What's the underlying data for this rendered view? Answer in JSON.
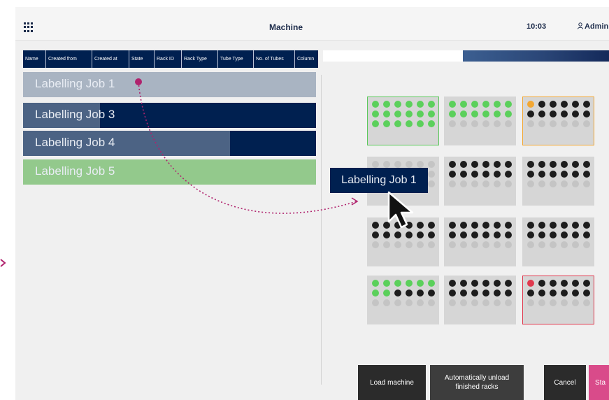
{
  "header": {
    "title": "Machine",
    "time": "10:03",
    "user": "Admin"
  },
  "table": {
    "columns": [
      "Name",
      "Created from",
      "Created at",
      "State",
      "Rack ID",
      "Rack Type",
      "Tube Type",
      "No. of Tubes",
      "Column"
    ]
  },
  "jobs": [
    {
      "label": "Labelling Job 1",
      "state": "dragging"
    },
    {
      "label": "Labelling Job 3",
      "progress": 0.26
    },
    {
      "label": "Labelling Job 4",
      "progress": 0.71
    },
    {
      "label": "Labelling Job 5",
      "state": "finished"
    }
  ],
  "drag_label": "Labelling Job 1",
  "racks": [
    {
      "state": "done",
      "tubes": [
        "g",
        "g",
        "g",
        "g",
        "g",
        "g",
        "g",
        "g",
        "g",
        "g",
        "g",
        "g",
        "g",
        "g",
        "g",
        "g",
        "g",
        "g"
      ]
    },
    {
      "state": "normal",
      "tubes": [
        "g",
        "g",
        "g",
        "g",
        "g",
        "g",
        "g",
        "g",
        "g",
        "g",
        "g",
        "g",
        "e",
        "e",
        "e",
        "e",
        "e",
        "e"
      ]
    },
    {
      "state": "warning",
      "tubes": [
        "o",
        "d",
        "d",
        "d",
        "d",
        "d",
        "d",
        "d",
        "d",
        "d",
        "d",
        "d",
        "e",
        "e",
        "e",
        "e",
        "e",
        "e"
      ]
    },
    {
      "state": "normal",
      "tubes": [
        "e",
        "e",
        "e",
        "e",
        "e",
        "e",
        "e",
        "e",
        "e",
        "e",
        "e",
        "e",
        "e",
        "e",
        "e",
        "e",
        "e",
        "e"
      ]
    },
    {
      "state": "normal",
      "tubes": [
        "d",
        "d",
        "d",
        "d",
        "d",
        "d",
        "d",
        "d",
        "d",
        "d",
        "d",
        "d",
        "e",
        "e",
        "e",
        "e",
        "e",
        "e"
      ]
    },
    {
      "state": "normal",
      "tubes": [
        "d",
        "d",
        "d",
        "d",
        "d",
        "d",
        "d",
        "d",
        "d",
        "d",
        "d",
        "d",
        "e",
        "e",
        "e",
        "e",
        "e",
        "e"
      ]
    },
    {
      "state": "normal",
      "tubes": [
        "d",
        "d",
        "d",
        "d",
        "d",
        "d",
        "d",
        "d",
        "d",
        "d",
        "d",
        "d",
        "e",
        "e",
        "e",
        "e",
        "e",
        "e"
      ]
    },
    {
      "state": "normal",
      "tubes": [
        "d",
        "d",
        "d",
        "d",
        "d",
        "d",
        "d",
        "d",
        "d",
        "d",
        "d",
        "d",
        "e",
        "e",
        "e",
        "e",
        "e",
        "e"
      ]
    },
    {
      "state": "normal",
      "tubes": [
        "d",
        "d",
        "d",
        "d",
        "d",
        "d",
        "d",
        "d",
        "d",
        "d",
        "d",
        "d",
        "e",
        "e",
        "e",
        "e",
        "e",
        "e"
      ]
    },
    {
      "state": "normal",
      "tubes": [
        "g",
        "g",
        "g",
        "g",
        "g",
        "g",
        "g",
        "g",
        "d",
        "d",
        "d",
        "d",
        "e",
        "e",
        "e",
        "e",
        "e",
        "e"
      ]
    },
    {
      "state": "normal",
      "tubes": [
        "d",
        "d",
        "d",
        "d",
        "d",
        "d",
        "d",
        "d",
        "d",
        "d",
        "d",
        "d",
        "e",
        "e",
        "e",
        "e",
        "e",
        "e"
      ]
    },
    {
      "state": "error",
      "tubes": [
        "r",
        "d",
        "d",
        "d",
        "d",
        "d",
        "d",
        "d",
        "d",
        "d",
        "d",
        "d",
        "e",
        "e",
        "e",
        "e",
        "e",
        "e"
      ]
    }
  ],
  "buttons": {
    "load": "Load machine",
    "unload": "Automatically unload finished racks",
    "cancel": "Cancel",
    "start": "Sta"
  },
  "colors": {
    "navy": "#002050",
    "job_progress": "#4c6384",
    "job_finished": "#93c98c",
    "tube_done": "#5bd05b",
    "tube_filled": "#1d1d1d",
    "tube_empty": "#c4c4c4",
    "warning": "#f2a733",
    "error": "#e0394e",
    "connector": "#b0226d",
    "start_button": "#d94b8a"
  },
  "icons": [
    "grid-menu-icon",
    "user-icon",
    "cursor-arrow-icon",
    "drag-path-icon",
    "arrow-right-icon"
  ]
}
